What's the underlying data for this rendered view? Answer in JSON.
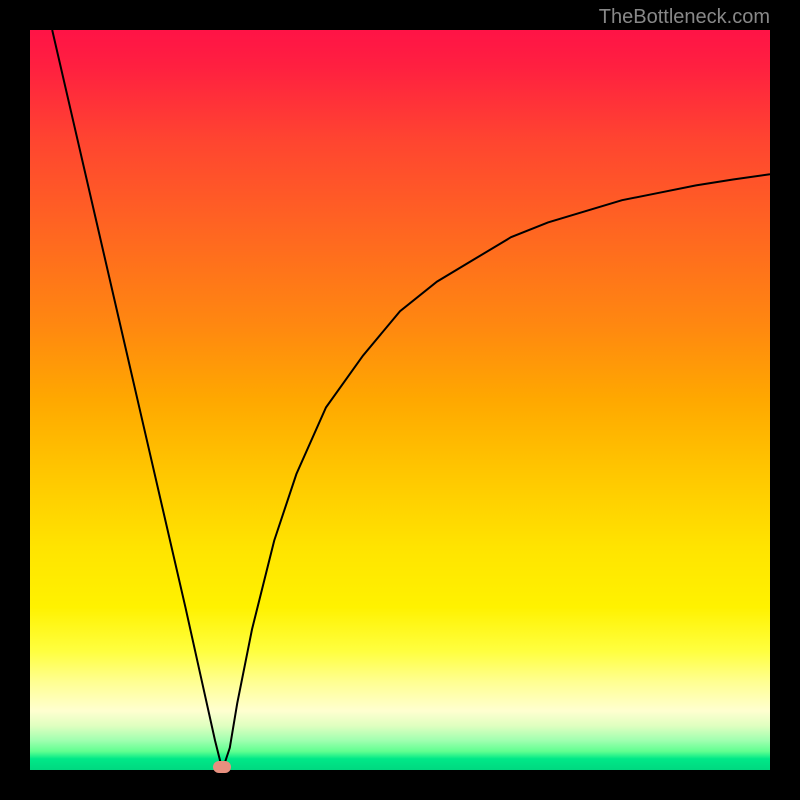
{
  "watermark": "TheBottleneck.com",
  "colors": {
    "top": "#ff1346",
    "mid_high": "#ff6820",
    "mid": "#ffc700",
    "mid_low": "#ffff40",
    "bottom": "#00d880",
    "marker": "#e8907f",
    "border": "#000000"
  },
  "chart_data": {
    "type": "line",
    "title": "",
    "xlabel": "",
    "ylabel": "",
    "xlim": [
      0,
      100
    ],
    "ylim": [
      0,
      100
    ],
    "description": "Bottleneck curve: steep linear drop from top-left to minimum at x~26, then logarithmic rise toward right side peaking near 75% height.",
    "minimum_x": 26,
    "minimum_y": 0,
    "series": [
      {
        "name": "bottleneck",
        "x": [
          3,
          6,
          9,
          12,
          15,
          18,
          21,
          23,
          25,
          26,
          27,
          28,
          30,
          33,
          36,
          40,
          45,
          50,
          55,
          60,
          65,
          70,
          75,
          80,
          85,
          90,
          95,
          100
        ],
        "y": [
          100,
          87,
          74,
          61,
          48,
          35,
          22,
          13,
          4,
          0,
          3,
          9,
          19,
          31,
          40,
          49,
          56,
          62,
          66,
          69,
          72,
          74,
          75.5,
          77,
          78,
          79,
          79.8,
          80.5
        ]
      }
    ],
    "marker": {
      "x": 26,
      "y": 0,
      "shape": "rounded-rect"
    }
  }
}
